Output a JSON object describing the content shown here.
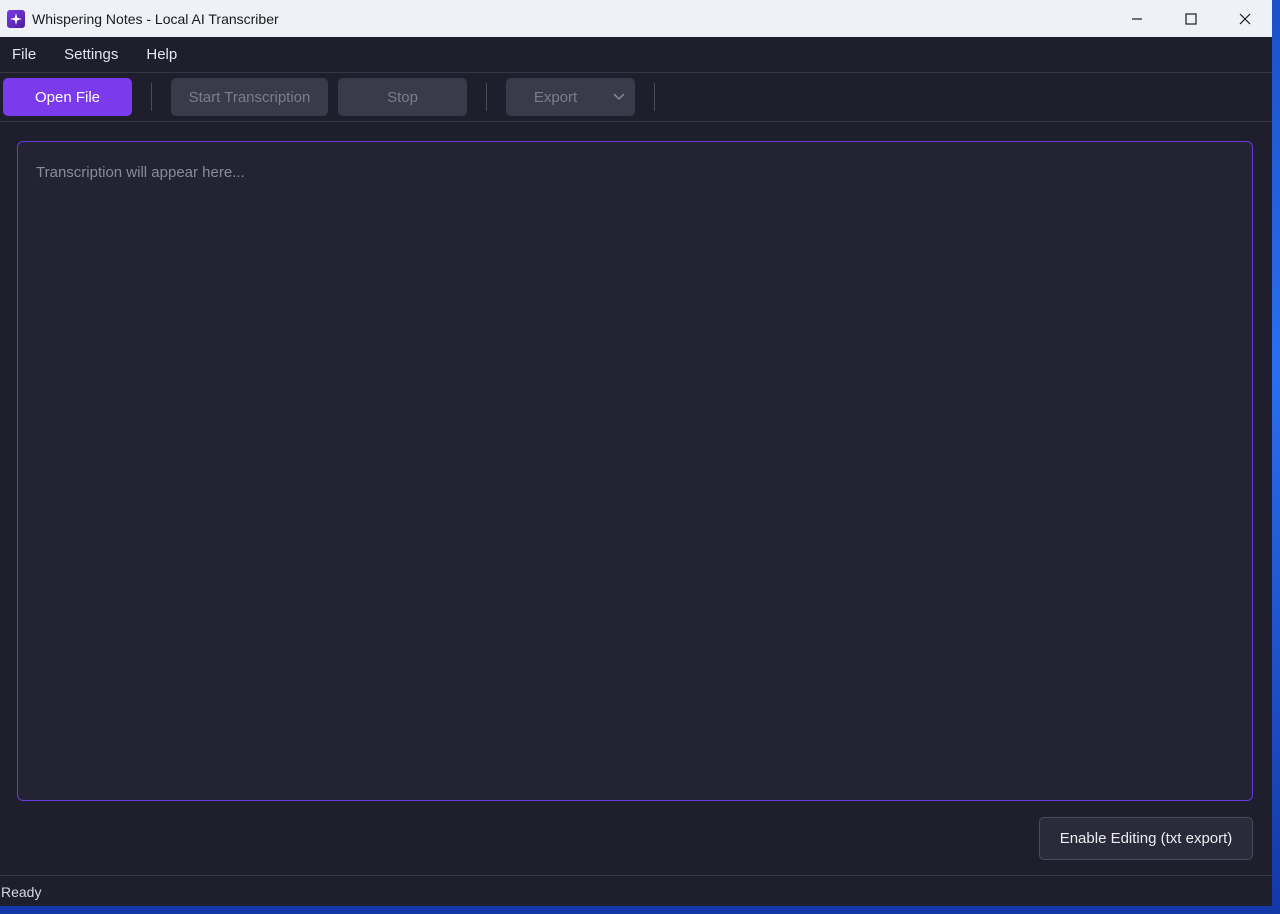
{
  "window": {
    "title": "Whispering Notes - Local AI Transcriber",
    "icon": "app-sparkle-icon",
    "controls": [
      "minimize-icon",
      "maximize-icon",
      "close-icon"
    ]
  },
  "menu": {
    "items": [
      {
        "label": "File"
      },
      {
        "label": "Settings"
      },
      {
        "label": "Help"
      }
    ]
  },
  "toolbar": {
    "open_file": "Open File",
    "start_transcription": "Start Transcription",
    "stop": "Stop",
    "export": "Export",
    "export_icon": "chevron-down-icon"
  },
  "editor": {
    "placeholder": "Transcription will appear here..."
  },
  "footer": {
    "enable_editing": "Enable Editing (txt export)"
  },
  "status": {
    "text": "Ready"
  },
  "colors": {
    "accent": "#7c3aed",
    "background": "#1e1e2c",
    "editor_border": "#6d38d8"
  }
}
